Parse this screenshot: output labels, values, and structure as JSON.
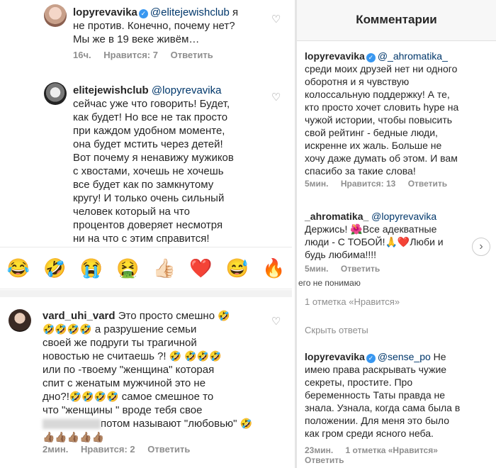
{
  "left": {
    "comment1": {
      "username": "lopyrevavika",
      "mention": "@elitejewishclub",
      "text_a": " я",
      "text_b": "не против. Конечно, почему нет?",
      "text_c": "Мы же в 19 веке живём…",
      "time": "16ч.",
      "likes": "Нравится: 7",
      "reply": "Ответить"
    },
    "comment2": {
      "username": "elitejewishclub",
      "mention": "@lopyrevavika",
      "lines": [
        "сейчас уже что говорить! Будет,",
        "как будет! Но все не так просто",
        "при каждом удобном моменте,",
        "она будет мстить через детей!",
        "Вот почему я ненавижу мужиков",
        "с хвостами, хочешь не хочешь",
        "все будет как по замкнутому",
        "кругу! И только очень сильный",
        "человек который на что",
        "процентов доверяет несмотря",
        "ни на что с этим справится!"
      ]
    },
    "emoji_bar": [
      "😂",
      "🤣",
      "😭",
      "🤮",
      "👍🏻",
      "❤️",
      "😅",
      "🔥"
    ],
    "comment3": {
      "username": "vard_uhi_vard",
      "line1": " Это просто смешно ",
      "line2_emoji": "🤣🤣🤣🤣",
      "line2": " а разрушение семьи",
      "line3": "своей же подруги ты трагичной",
      "line4": "новостью не считаешь ?! ",
      "line4_emoji": "🤣 🤣🤣🤣",
      "line5": "или по -твоему \"женщина\" которая",
      "line6": "спит с женатым мужчиной это не",
      "line7a": "дно?!",
      "line7_emoji": "🤣🤣🤣🤣",
      "line7b": " самое смешное то",
      "line8": "что \"женщины \" вроде тебя свое",
      "line9": "потом называют \"любовью\" ",
      "line9_emoji": "🤣",
      "thumbs": "👍🏽👍🏽👍🏽👍🏽👍🏽",
      "time": "2мин.",
      "likes": "Нравится: 2",
      "reply": "Ответить"
    }
  },
  "right": {
    "header_title": "Комментарии",
    "comment1": {
      "username": "lopyrevavika",
      "mention": "@_ahromatika_",
      "lines": [
        "среди моих друзей нет ни одного",
        "оборотня и я чувствую",
        "колоссальную поддержку! А те,",
        "кто просто хочет словить hype на",
        "чужой истории, чтобы повысить",
        "свой рейтинг - бедные люди,",
        "искренне их жаль. Больше не",
        "хочу даже думать об этом. И вам",
        "спасибо за такие слова!"
      ],
      "time": "5мин.",
      "likes": "Нравится: 13",
      "reply": "Ответить"
    },
    "comment2": {
      "username": "_ahromatika_",
      "mention": "@lopyrevavika",
      "line1": "Держись! ",
      "line1_emoji": "🌺",
      "line1b": "Все адекватные",
      "line2": "люди - С ТОБОЙ!",
      "line2_emoji": "🙏❤️",
      "line2b": "Люби и",
      "line3": "будь любима!!!!",
      "time": "5мин.",
      "reply": "Ответить"
    },
    "cut_text": "его не понимаю",
    "likes_line": "1 отметка «Нравится»",
    "hide_replies": "Скрыть ответы",
    "comment3": {
      "username": "lopyrevavika",
      "mention": "@sense_po",
      "line1": " Не",
      "lines": [
        "имею права раскрывать чужие",
        "секреты, простите. Про",
        "беременность Таты правда не",
        "знала. Узнала, когда сама была в",
        "положении.  Для меня это было",
        "как гром среди ясного неба."
      ],
      "time": "23мин.",
      "likes": "1 отметка «Нравится»",
      "reply": "Ответить"
    }
  }
}
